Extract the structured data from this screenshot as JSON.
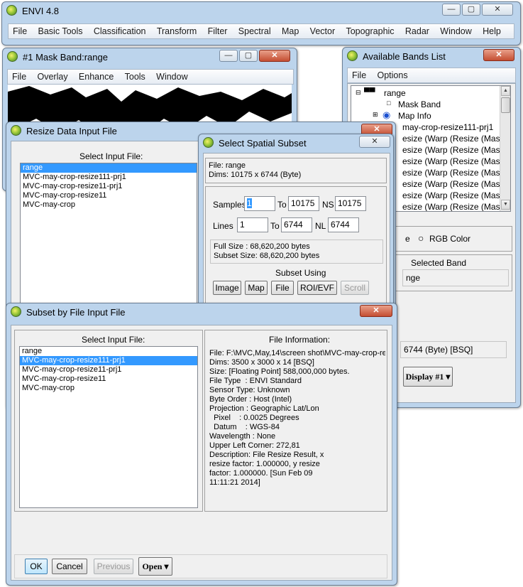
{
  "envi_main": {
    "title": "ENVI 4.8",
    "menu": [
      "File",
      "Basic Tools",
      "Classification",
      "Transform",
      "Filter",
      "Spectral",
      "Map",
      "Vector",
      "Topographic",
      "Radar",
      "Window",
      "Help"
    ]
  },
  "mask_window": {
    "title": "#1 Mask Band:range",
    "menu": [
      "File",
      "Overlay",
      "Enhance",
      "Tools",
      "Window"
    ]
  },
  "bands_list": {
    "title": "Available Bands List",
    "menu": [
      "File",
      "Options"
    ],
    "tree_root": "range",
    "mask_band": "Mask Band",
    "map_info": "Map Info",
    "partial_items": [
      "may-crop-resize111-prj1",
      "esize (Warp (Resize (Mask (l",
      "esize (Warp (Resize (Mask (l",
      "esize (Warp (Resize (Mask (l",
      "esize (Warp (Resize (Mask (l",
      "esize (Warp (Resize (Mask (l",
      "esize (Warp (Resize (Mask (l",
      "esize (Warp (Resize (Mask (l"
    ],
    "gray_label_partial": "e",
    "rgb_color": "RGB Color",
    "selected_band_label": "Selected Band",
    "selected_band_value": "nge",
    "dims_partial": "6744 (Byte) [BSQ]",
    "display_button": "Display #1"
  },
  "resize_dialog": {
    "title": "Resize Data Input File",
    "select_label": "Select Input File:",
    "files": [
      "range",
      "MVC-may-crop-resize111-prj1",
      "MVC-may-crop-resize11-prj1",
      "MVC-may-crop-resize11",
      "MVC-may-crop"
    ],
    "selected_index": 0
  },
  "spatial_subset": {
    "title": "Select Spatial Subset",
    "file_line": "File: range",
    "dims_line": "Dims: 10175 x 6744 (Byte)",
    "samples_label": "Samples",
    "samples_from": "1",
    "to_label": "To",
    "samples_to": "10175",
    "ns_label": "NS",
    "ns_value": "10175",
    "lines_label": "Lines",
    "lines_from": "1",
    "lines_to": "6744",
    "nl_label": "NL",
    "nl_value": "6744",
    "full_size": "Full Size  : 68,620,200 bytes",
    "subset_size": "Subset Size: 68,620,200 bytes",
    "subset_using": "Subset Using",
    "buttons": {
      "image": "Image",
      "map": "Map",
      "file": "File",
      "roi": "ROI/EVF",
      "scroll": "Scroll"
    }
  },
  "subset_by_file": {
    "title": "Subset by File Input File",
    "select_label": "Select Input File:",
    "files": [
      "range",
      "MVC-may-crop-resize111-prj1",
      "MVC-may-crop-resize11-prj1",
      "MVC-may-crop-resize11",
      "MVC-may-crop"
    ],
    "selected_index": 1,
    "file_info_label": "File Information:",
    "info_lines": [
      "File: F:\\MVC,May,14\\screen shot\\MVC-may-crop-re:",
      "Dims: 3500 x 3000 x 14 [BSQ]",
      "Size: [Floating Point] 588,000,000 bytes.",
      "File Type  : ENVI Standard",
      "Sensor Type: Unknown",
      "Byte Order : Host (Intel)",
      "Projection : Geographic Lat/Lon",
      "  Pixel    : 0.0025 Degrees",
      "  Datum    : WGS-84",
      "Wavelength : None",
      "Upper Left Corner: 272,81",
      "Description: File Resize Result, x",
      "resize factor: 1.000000, y resize",
      "factor: 1.000000. [Sun Feb 09",
      "11:11:21 2014]"
    ],
    "buttons": {
      "ok": "OK",
      "cancel": "Cancel",
      "previous": "Previous",
      "open": "Open"
    }
  },
  "colors": {
    "title_bg": "#bcd4ec",
    "selection": "#3399ff",
    "close_red": "#c44e32"
  }
}
